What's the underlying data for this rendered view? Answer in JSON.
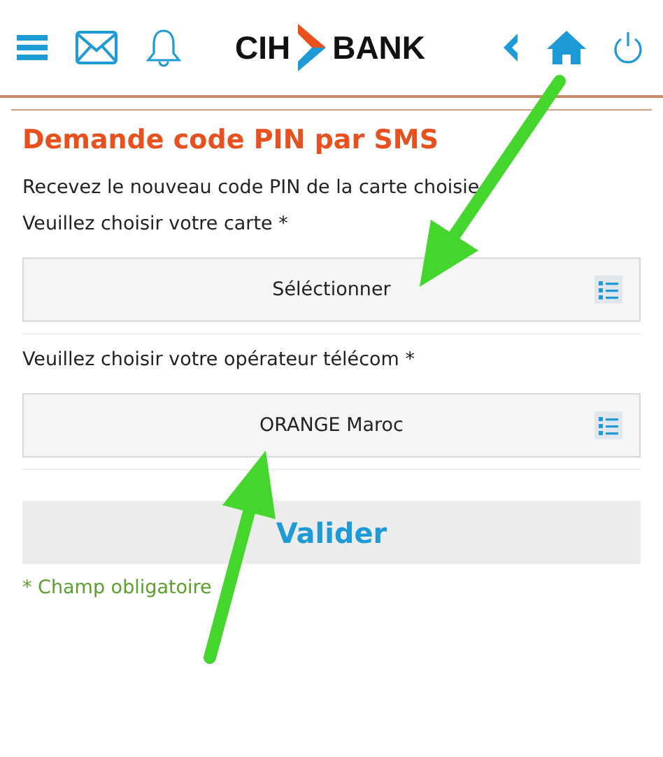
{
  "header": {
    "logo": {
      "left": "CIH",
      "right": "BANK"
    }
  },
  "title": "Demande code PIN par SMS",
  "intro": "Recevez le nouveau code PIN de la carte choisie",
  "fields": [
    {
      "label": "Veuillez choisir votre carte *",
      "value": "Séléctionner"
    },
    {
      "label": "Veuillez choisir votre opérateur télécom *",
      "value": "ORANGE Maroc"
    }
  ],
  "submit": "Valider",
  "footnote": "* Champ obligatoire"
}
